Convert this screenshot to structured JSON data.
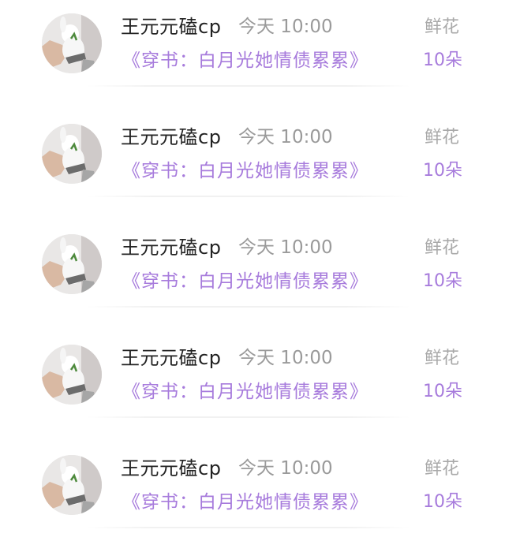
{
  "list": {
    "items": [
      {
        "nickname": "王元元磕cp",
        "time": "今天 10:00",
        "gift_name": "鲜花",
        "book_title": "《穿书：白月光她情债累累》",
        "gift_count": "10朵",
        "avatar_icon": "user-avatar-icon"
      },
      {
        "nickname": "王元元磕cp",
        "time": "今天 10:00",
        "gift_name": "鲜花",
        "book_title": "《穿书：白月光她情债累累》",
        "gift_count": "10朵",
        "avatar_icon": "user-avatar-icon"
      },
      {
        "nickname": "王元元磕cp",
        "time": "今天 10:00",
        "gift_name": "鲜花",
        "book_title": "《穿书：白月光她情债累累》",
        "gift_count": "10朵",
        "avatar_icon": "user-avatar-icon"
      },
      {
        "nickname": "王元元磕cp",
        "time": "今天 10:00",
        "gift_name": "鲜花",
        "book_title": "《穿书：白月光她情债累累》",
        "gift_count": "10朵",
        "avatar_icon": "user-avatar-icon"
      },
      {
        "nickname": "王元元磕cp",
        "time": "今天 10:00",
        "gift_name": "鲜花",
        "book_title": "《穿书：白月光她情债累累》",
        "gift_count": "10朵",
        "avatar_icon": "user-avatar-icon"
      }
    ]
  },
  "colors": {
    "accent_purple": "#a77bdc",
    "nickname_text": "#222222",
    "muted_text": "#9a9a9a",
    "gift_name_text": "#a9a9a9",
    "divider": "#f1f1f1"
  }
}
